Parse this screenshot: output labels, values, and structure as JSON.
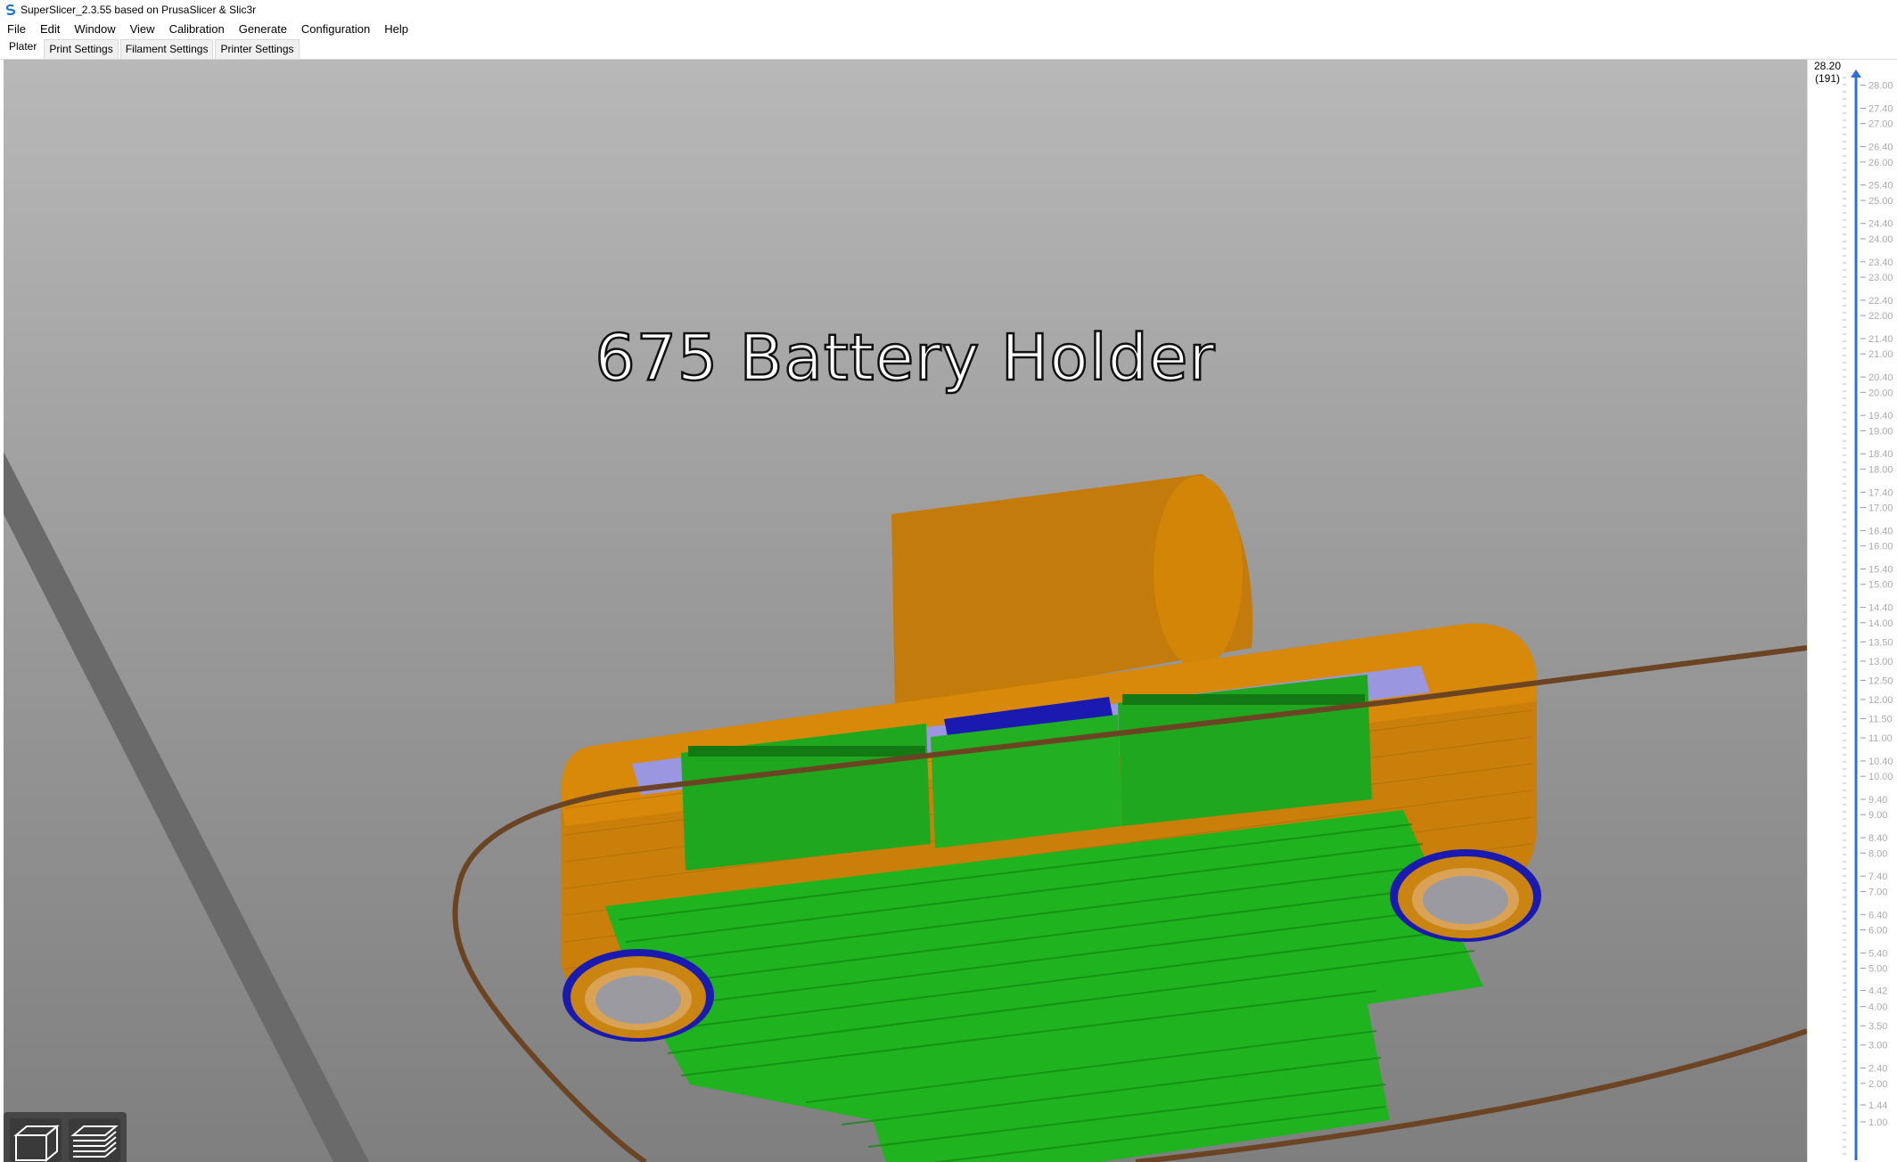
{
  "window": {
    "title": "SuperSlicer_2.3.55 based on PrusaSlicer & Slic3r"
  },
  "menu": [
    "File",
    "Edit",
    "Window",
    "View",
    "Calibration",
    "Generate",
    "Configuration",
    "Help"
  ],
  "tabs": [
    "Plater",
    "Print Settings",
    "Filament Settings",
    "Printer Settings"
  ],
  "active_tab": "Plater",
  "viewport": {
    "object_label": "675 Battery Holder"
  },
  "view_buttons": [
    "3d-view-icon",
    "preview-layers-icon"
  ],
  "layer_slider": {
    "top_value": "28.20",
    "top_layer": "(191)",
    "ticks": [
      "28.00",
      "27.40",
      "27.00",
      "26.40",
      "26.00",
      "25.40",
      "25.00",
      "24.40",
      "24.00",
      "23.40",
      "23.00",
      "22.40",
      "22.00",
      "21.40",
      "21.00",
      "20.40",
      "20.00",
      "19.40",
      "19.00",
      "18.40",
      "18.00",
      "17.40",
      "17.00",
      "16.40",
      "16.00",
      "15.40",
      "15.00",
      "14.40",
      "14.00",
      "13.50",
      "13.00",
      "12.50",
      "12.00",
      "11.50",
      "11.00",
      "10.40",
      "10.00",
      "9.40",
      "9.00",
      "8.40",
      "8.00",
      "7.40",
      "7.00",
      "6.40",
      "6.00",
      "5.40",
      "5.00",
      "4.42",
      "4.00",
      "3.50",
      "3.00",
      "2.40",
      "2.00",
      "1.44",
      "1.00"
    ],
    "accent_color": "#2e6fd6"
  },
  "colors": {
    "external_perimeter": "#e08a00",
    "perimeter": "#c97f0a",
    "support": "#1fb31f",
    "travel": "#6b4423",
    "overhang": "#1a1ab0",
    "internal_infill": "#9a96e0"
  }
}
